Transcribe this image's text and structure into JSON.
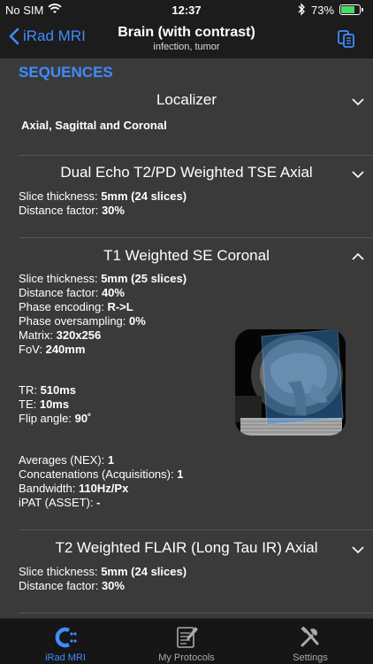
{
  "status_bar": {
    "carrier": "No SIM",
    "time": "12:37",
    "battery_text": "73%",
    "battery_level": 0.73
  },
  "nav": {
    "back_label": "iRad MRI",
    "title": "Brain (with contrast)",
    "subtitle": "infection, tumor",
    "action_icon": "copy-icon"
  },
  "section_title": "SEQUENCES",
  "sequences": [
    {
      "title": "Localizer",
      "expanded": false,
      "lines": [
        {
          "label": "",
          "value": "Axial, Sagittal and Coronal"
        }
      ]
    },
    {
      "title": "Dual Echo T2/PD Weighted TSE Axial",
      "expanded": false,
      "lines": [
        {
          "label": "Slice thickness: ",
          "value": "5mm (24 slices)"
        },
        {
          "label": "Distance factor: ",
          "value": "30%"
        }
      ]
    },
    {
      "title": "T1 Weighted SE Coronal",
      "expanded": true,
      "params_a": [
        {
          "label": "Slice thickness: ",
          "value": "5mm (25 slices)"
        },
        {
          "label": "Distance factor: ",
          "value": "40%"
        },
        {
          "label": "Phase encoding: ",
          "value": "R->L"
        },
        {
          "label": "Phase oversampling: ",
          "value": "0%"
        },
        {
          "label": "Matrix: ",
          "value": "320x256"
        },
        {
          "label": "FoV: ",
          "value": "240mm"
        }
      ],
      "params_b": [
        {
          "label": "TR: ",
          "value": "510ms"
        },
        {
          "label": "TE: ",
          "value": "10ms"
        },
        {
          "label": "Flip angle: ",
          "value": "90˚"
        }
      ],
      "params_c": [
        {
          "label": "Averages (NEX): ",
          "value": "1"
        },
        {
          "label": "Concatenations (Acquisitions): ",
          "value": "1"
        },
        {
          "label": "Bandwidth: ",
          "value": "110Hz/Px"
        },
        {
          "label": "iPAT (ASSET): ",
          "value": "-"
        }
      ]
    },
    {
      "title": "T2 Weighted FLAIR (Long Tau IR) Axial",
      "expanded": false,
      "lines": [
        {
          "label": "Slice thickness: ",
          "value": "5mm (24 slices)"
        },
        {
          "label": "Distance factor: ",
          "value": "30%"
        }
      ]
    }
  ],
  "tabs": [
    {
      "label": "iRad MRI",
      "icon": "irad-mri-icon",
      "active": true
    },
    {
      "label": "My Protocols",
      "icon": "protocols-icon",
      "active": false
    },
    {
      "label": "Settings",
      "icon": "settings-icon",
      "active": false
    }
  ],
  "colors": {
    "accent": "#3f8cff",
    "background": "#3a3a3a",
    "bar": "#1c1c1c"
  }
}
